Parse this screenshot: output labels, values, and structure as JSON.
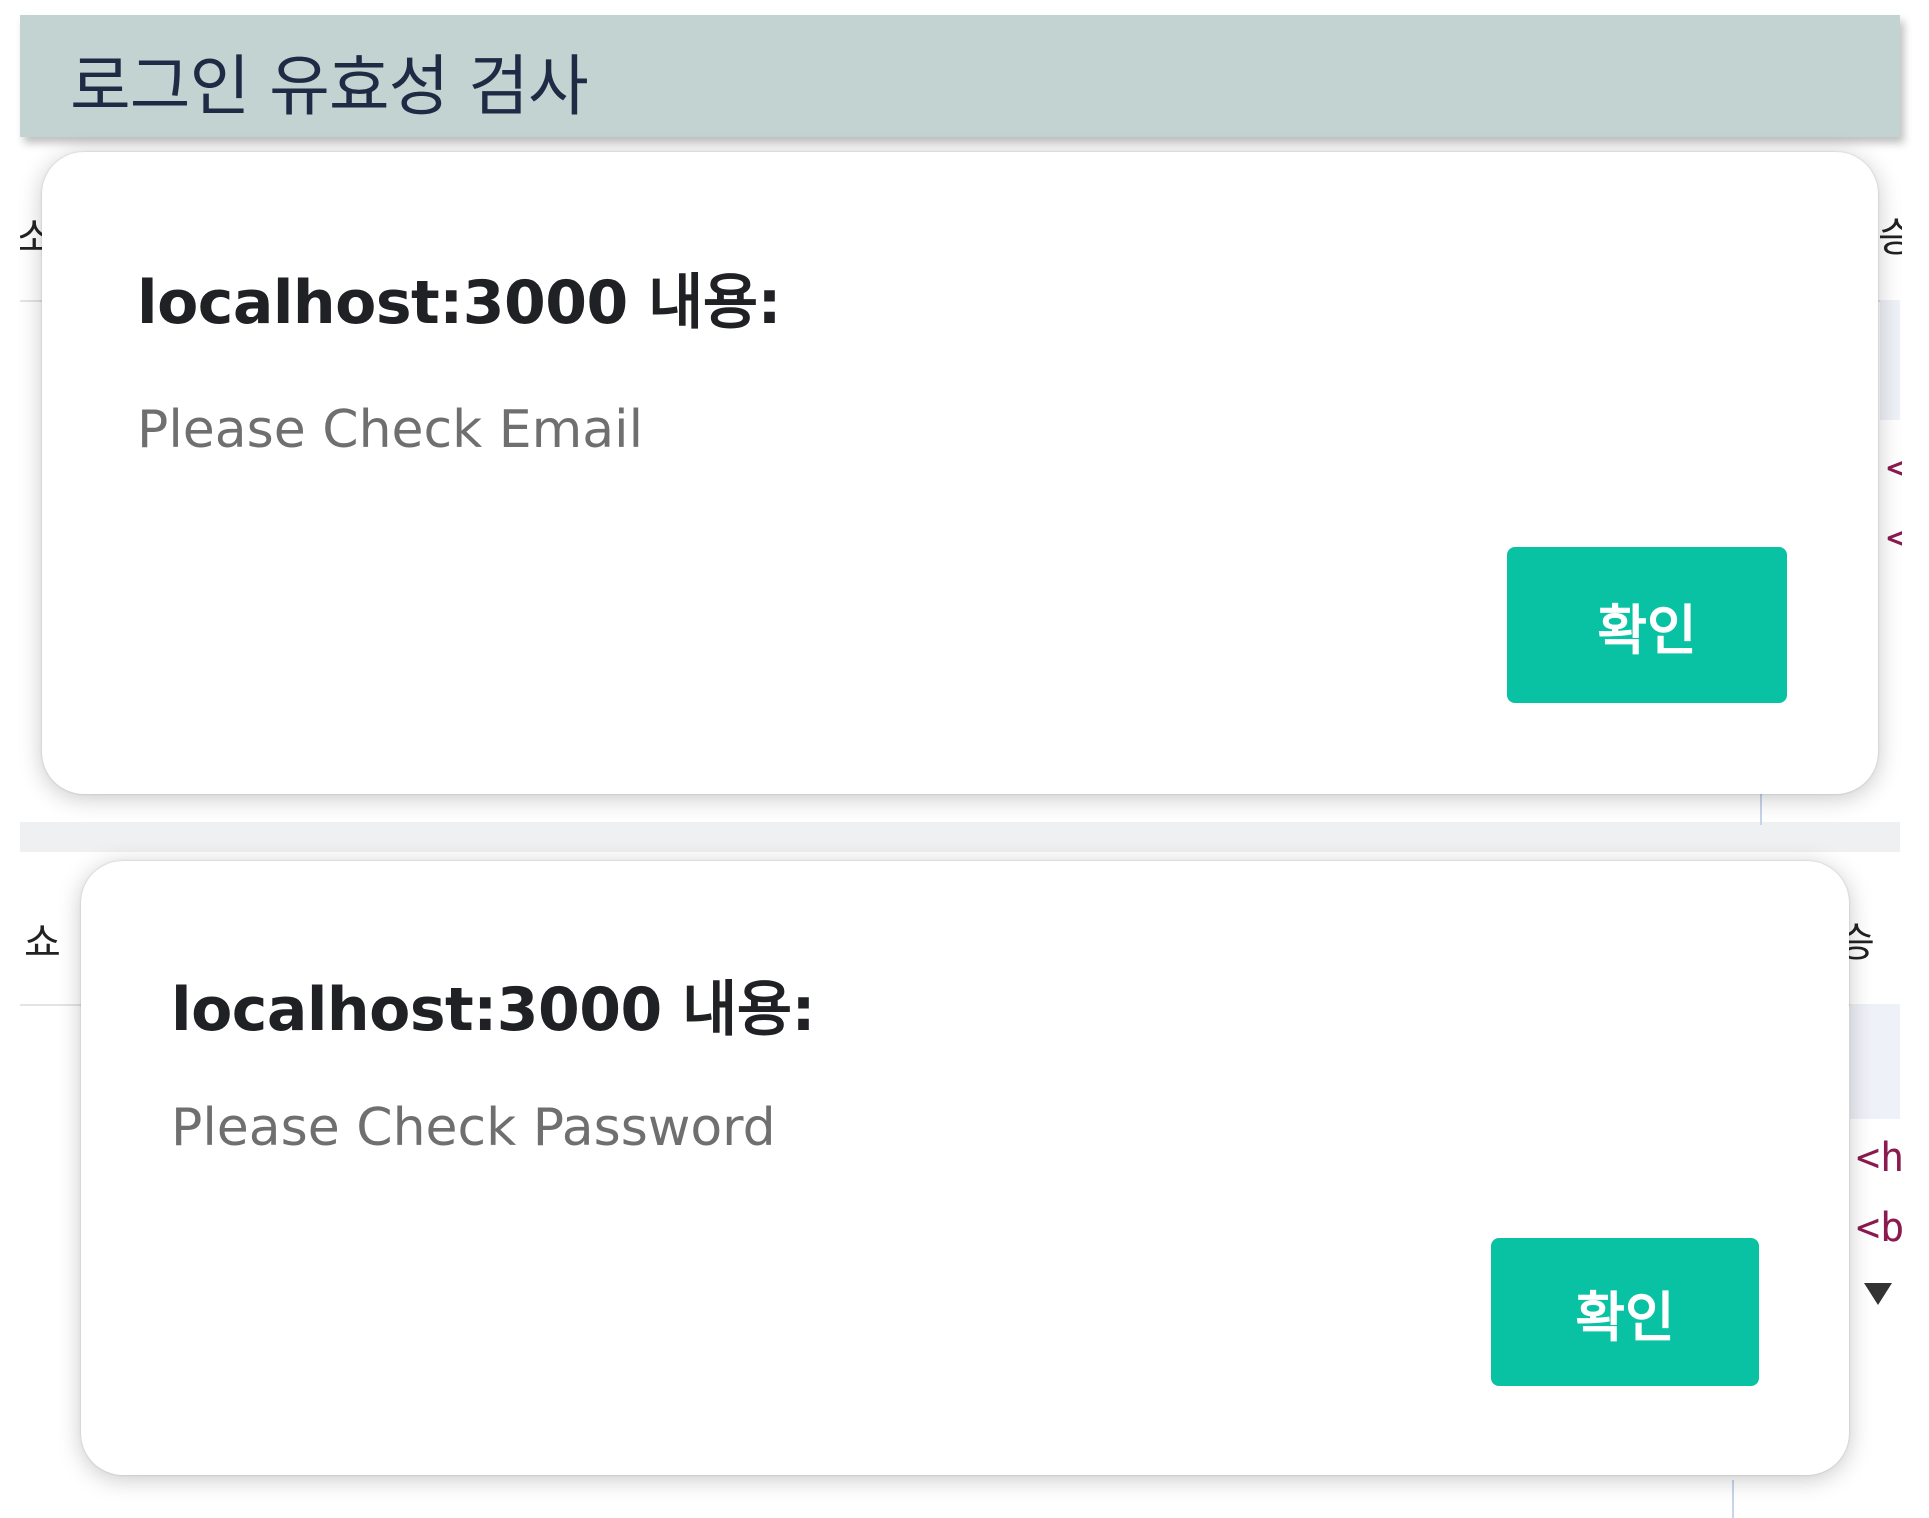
{
  "header": {
    "title": "로그인 유효성 검사"
  },
  "background": {
    "top_left_fragment": "소",
    "top_right_fragment": "승",
    "bottom_left_fragment": "쇼",
    "bottom_right_fragment": "승",
    "code_lines_top": [
      "<",
      "<"
    ],
    "code_lines_bottom": [
      "<h",
      "<b"
    ]
  },
  "dialogs": [
    {
      "title": "localhost:3000 내용:",
      "message": "Please Check Email",
      "confirm_label": "확인"
    },
    {
      "title": "localhost:3000 내용:",
      "message": "Please Check Password",
      "confirm_label": "확인"
    }
  ],
  "colors": {
    "header_bg": "#c2d3d2",
    "header_text": "#1f2a44",
    "button_bg": "#09c2a3",
    "button_text": "#ffffff",
    "message_text": "#6f6f6f"
  }
}
